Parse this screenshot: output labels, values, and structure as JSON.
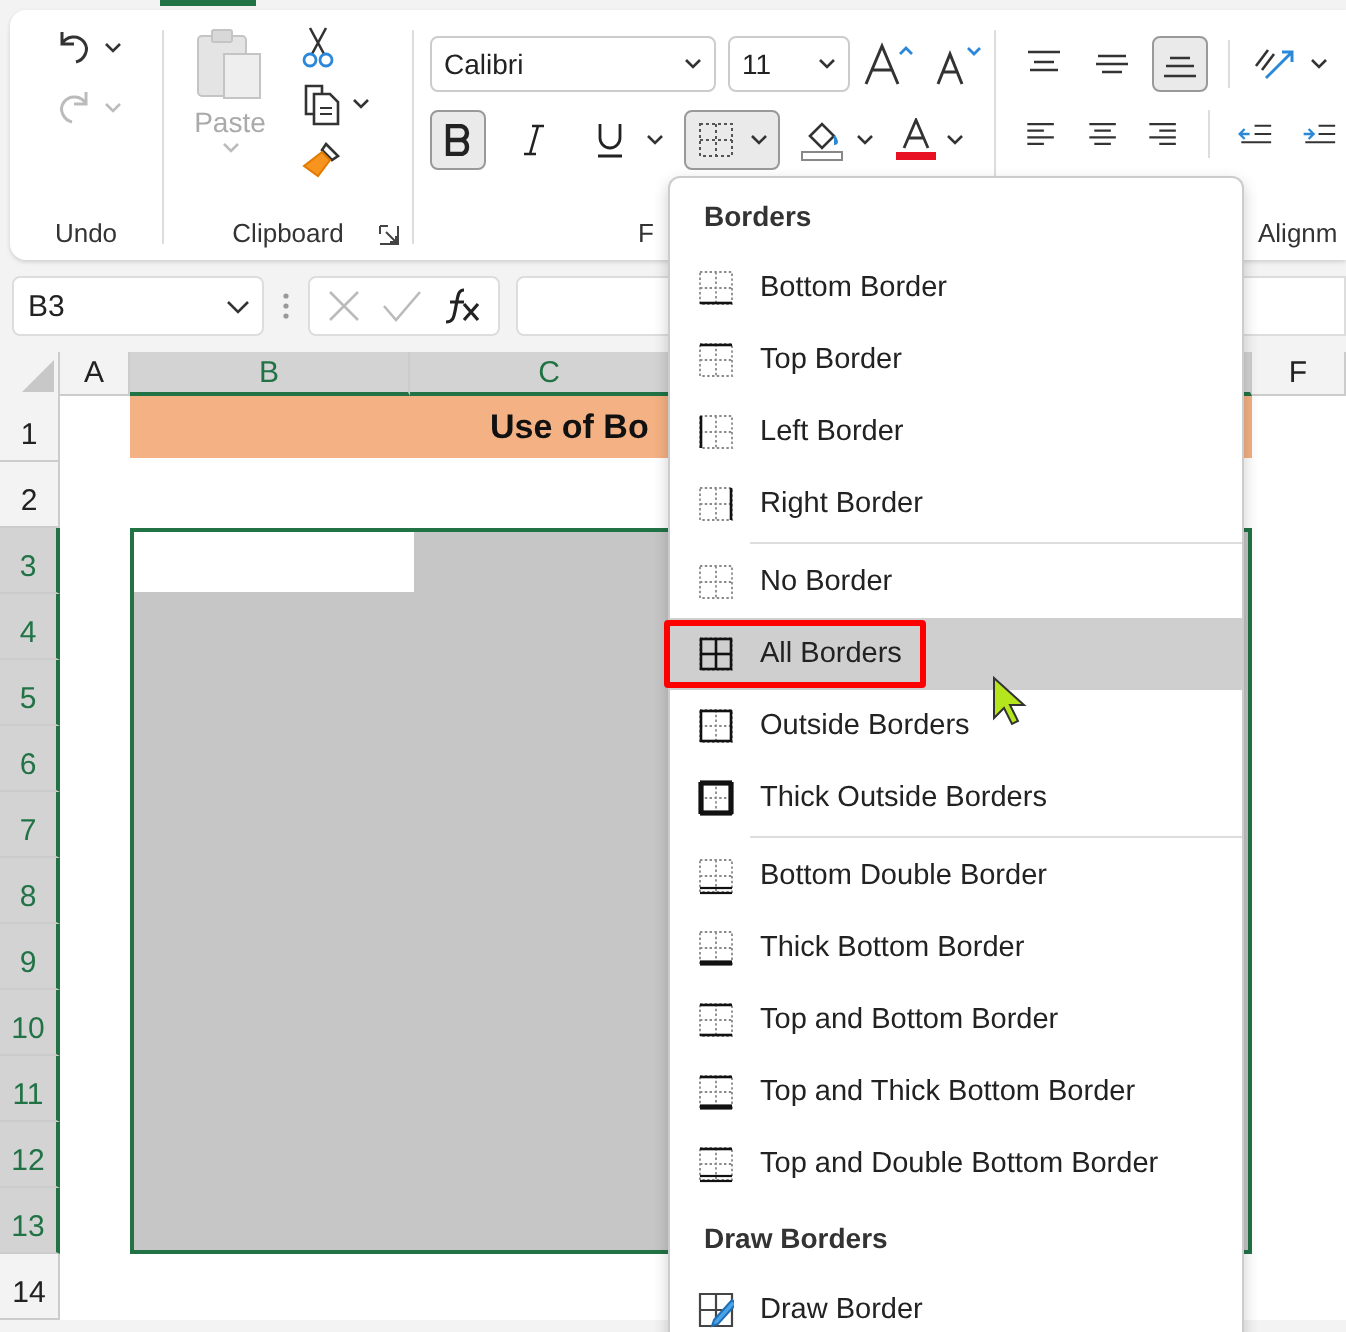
{
  "undo_group": {
    "label": "Undo",
    "undo": {
      "disabled": false
    },
    "redo": {
      "disabled": true
    }
  },
  "clipboard_group": {
    "label": "Clipboard",
    "paste": {
      "label": "Paste",
      "disabled": true
    }
  },
  "font_group": {
    "label": "F",
    "font_name": "Calibri",
    "font_size": "11",
    "bold": {
      "pressed": true
    },
    "italic": {
      "pressed": false
    },
    "underline": {
      "pressed": false
    },
    "borders": {
      "pressed": true
    }
  },
  "alignment_group": {
    "label": "Alignm",
    "top_align": {
      "pressed": false
    },
    "middle_align": {
      "pressed": false
    },
    "bottom_align": {
      "pressed": true
    }
  },
  "formula_bar": {
    "name_box": "B3"
  },
  "sheet": {
    "columns": [
      {
        "label": "A",
        "selected": false
      },
      {
        "label": "B",
        "selected": true
      },
      {
        "label": "C",
        "selected": true
      },
      {
        "label": "F",
        "selected": false
      }
    ],
    "rows": [
      {
        "label": "1",
        "selected": false,
        "title": "Use of Bo"
      },
      {
        "label": "2",
        "selected": false
      },
      {
        "label": "3",
        "selected": true
      },
      {
        "label": "4",
        "selected": true
      },
      {
        "label": "5",
        "selected": true
      },
      {
        "label": "6",
        "selected": true
      },
      {
        "label": "7",
        "selected": true
      },
      {
        "label": "8",
        "selected": true
      },
      {
        "label": "9",
        "selected": true
      },
      {
        "label": "10",
        "selected": true
      },
      {
        "label": "11",
        "selected": true
      },
      {
        "label": "12",
        "selected": true
      },
      {
        "label": "13",
        "selected": true
      },
      {
        "label": "14",
        "selected": false
      }
    ]
  },
  "borders_menu": {
    "sections": [
      {
        "title": "Borders",
        "groups": [
          [
            {
              "label": "Bottom Border",
              "kind": "bottom",
              "selected": false
            },
            {
              "label": "Top Border",
              "kind": "top",
              "selected": false
            },
            {
              "label": "Left Border",
              "kind": "left",
              "selected": false
            },
            {
              "label": "Right Border",
              "kind": "right",
              "selected": false
            }
          ],
          [
            {
              "label": "No Border",
              "kind": "none",
              "selected": false
            },
            {
              "label": "All Borders",
              "kind": "all",
              "selected": true
            },
            {
              "label": "Outside Borders",
              "kind": "outside",
              "selected": false
            },
            {
              "label": "Thick Outside Borders",
              "kind": "thick_outside",
              "selected": false
            }
          ],
          [
            {
              "label": "Bottom Double Border",
              "kind": "bottom_double",
              "selected": false
            },
            {
              "label": "Thick Bottom Border",
              "kind": "thick_bottom",
              "selected": false
            },
            {
              "label": "Top and Bottom Border",
              "kind": "top_bottom",
              "selected": false
            },
            {
              "label": "Top and Thick Bottom Border",
              "kind": "top_thick_bottom",
              "selected": false
            },
            {
              "label": "Top and Double Bottom Border",
              "kind": "top_double_bottom",
              "selected": false
            }
          ]
        ]
      },
      {
        "title": "Draw Borders",
        "groups": [
          [
            {
              "label": "Draw Border",
              "kind": "draw",
              "selected": false
            }
          ]
        ]
      }
    ]
  }
}
